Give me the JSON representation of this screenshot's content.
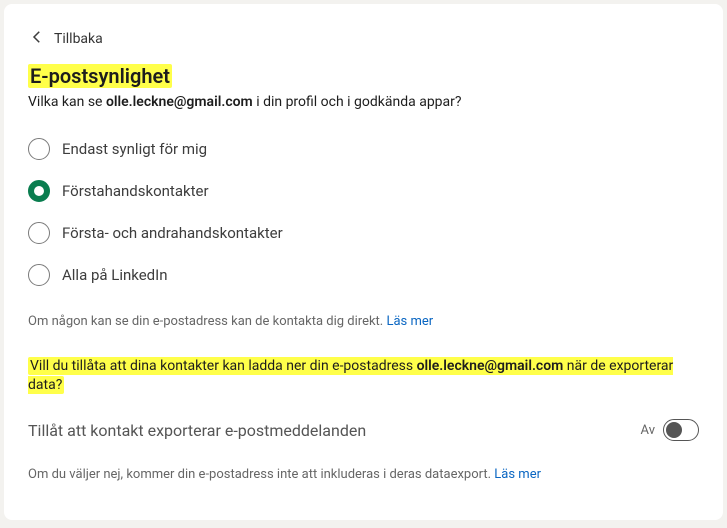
{
  "back_label": "Tillbaka",
  "title": "E-postsynlighet",
  "subtitle_prefix": "Vilka kan se ",
  "email": "olle.leckne@gmail.com",
  "subtitle_suffix": " i din profil och i godkända appar?",
  "radio_options": [
    {
      "label": "Endast synligt för mig",
      "selected": false
    },
    {
      "label": "Förstahandskontakter",
      "selected": true
    },
    {
      "label": "Första- och andrahandskontakter",
      "selected": false
    },
    {
      "label": "Alla på LinkedIn",
      "selected": false
    }
  ],
  "helper_text": "Om någon kan se din e-postadress kan de kontakta dig direkt.",
  "learn_more": "Läs mer",
  "export_q_prefix": "Vill du tillåta att dina kontakter kan ladda ner din e-postadress ",
  "export_q_suffix": " när de exporterar data?",
  "toggle_label": "Tillåt att kontakt exporterar e-postmeddelanden",
  "toggle_state": "Av",
  "helper2_text": "Om du väljer nej, kommer din e-postadress inte att inkluderas i deras dataexport."
}
